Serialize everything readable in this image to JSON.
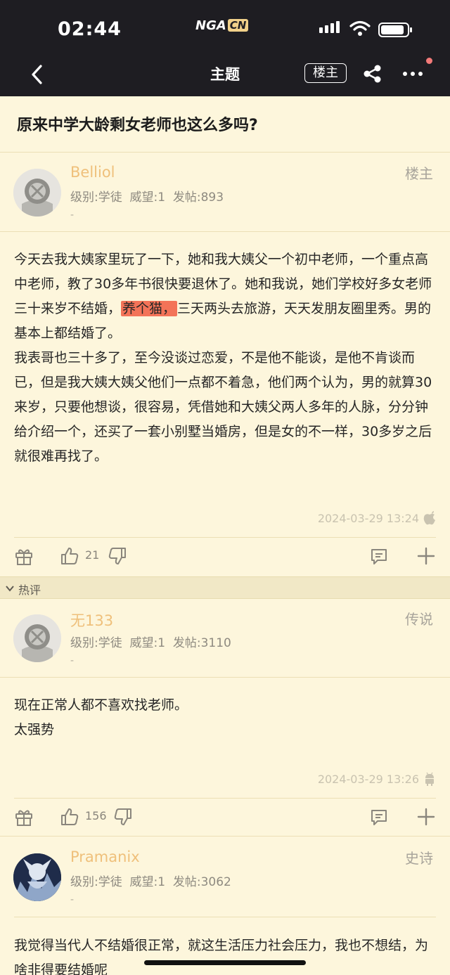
{
  "status": {
    "time": "02:44",
    "logo_main": "NGA",
    "logo_sub": "CN"
  },
  "nav": {
    "title": "主题",
    "op_badge": "楼主"
  },
  "topic": {
    "title": "原来中学大龄剩女老师也这么多吗?"
  },
  "posts": [
    {
      "username": "Belliol",
      "meta": "级别:学徒  威望:1  发帖:893",
      "dash": "-",
      "badge": "楼主",
      "para1_a": "今天去我大姨家里玩了一下，她和我大姨父一个初中老师，一个重点高中老师，教了30多年书很快要退休了。她和我说，她们学校好多女老师三十来岁不结婚，",
      "para1_hl": "养个猫，",
      "para1_b": "三天两头去旅游，天天发朋友圈里秀。男的基本上都结婚了。",
      "para2": "我表哥也三十多了，至今没谈过恋爱，不是他不能谈，是他不肯谈而已，但是我大姨大姨父他们一点都不着急，他们两个认为，男的就算30来岁，只要他想谈，很容易，凭借她和大姨父两人多年的人脉，分分钟给介绍一个，还买了一套小别墅当婚房，但是女的不一样，30多岁之后就很难再找了。",
      "time": "2024-03-29 13:24",
      "device_icon": "apple-icon",
      "likes": "21"
    },
    {
      "username": "无133",
      "meta": "级别:学徒  威望:1  发帖:3110",
      "dash": "-",
      "badge": "传说",
      "line1": "现在正常人都不喜欢找老师。",
      "line2": "太强势",
      "time": "2024-03-29 13:26",
      "device_icon": "android-icon",
      "likes": "156"
    },
    {
      "username": "Pramanix",
      "meta": "级别:学徒  威望:1  发帖:3062",
      "dash": "-",
      "badge": "史诗",
      "text": "我觉得当代人不结婚很正常，就这生活压力社会压力，我也不想结，为啥非得要结婚呢"
    }
  ],
  "hot": {
    "label": "热评"
  },
  "colors": {
    "username": "#efc07b",
    "highlight": "#f37358",
    "bg": "#fdf6dc",
    "bar": "#1e1d22"
  }
}
